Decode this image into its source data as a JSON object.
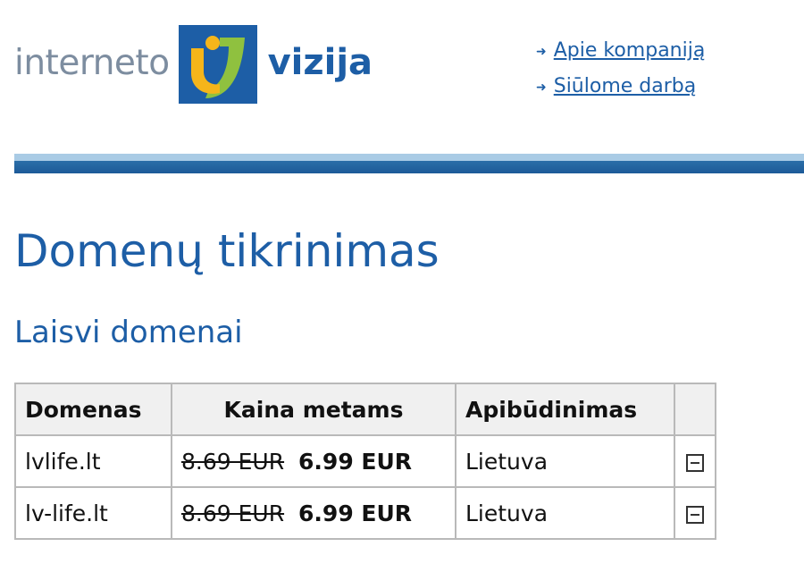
{
  "logo": {
    "word_left": "interneto",
    "word_right": "vizija",
    "colors": {
      "left_text": "#7d8da0",
      "right_text": "#1d5ea6",
      "mark_bg": "#1d5ea6",
      "mark_yellow": "#f5b51a",
      "mark_green": "#8fc13f"
    }
  },
  "nav": {
    "links": [
      {
        "label": "Apie kompaniją",
        "icon": "arrow-right-icon"
      },
      {
        "label": "Siūlome darbą",
        "icon": "arrow-right-icon"
      }
    ]
  },
  "page": {
    "title": "Domenų tikrinimas",
    "section_title": "Laisvi domenai"
  },
  "table": {
    "headers": {
      "domain": "Domenas",
      "price": "Kaina metams",
      "description": "Apibūdinimas"
    },
    "rows": [
      {
        "domain": "lvlife.lt",
        "old_price": "8.69 EUR",
        "new_price": "6.99 EUR",
        "description": "Lietuva",
        "action_icon": "collapse-minus-icon"
      },
      {
        "domain": "lv-life.lt",
        "old_price": "8.69 EUR",
        "new_price": "6.99 EUR",
        "description": "Lietuva",
        "action_icon": "collapse-minus-icon"
      }
    ]
  },
  "colors": {
    "brand_blue": "#1d5ea6",
    "divider_light": "#a9cbe5",
    "divider_dark": "#1d5a98",
    "table_border": "#b9b9b9",
    "header_bg": "#f0f0f0"
  }
}
